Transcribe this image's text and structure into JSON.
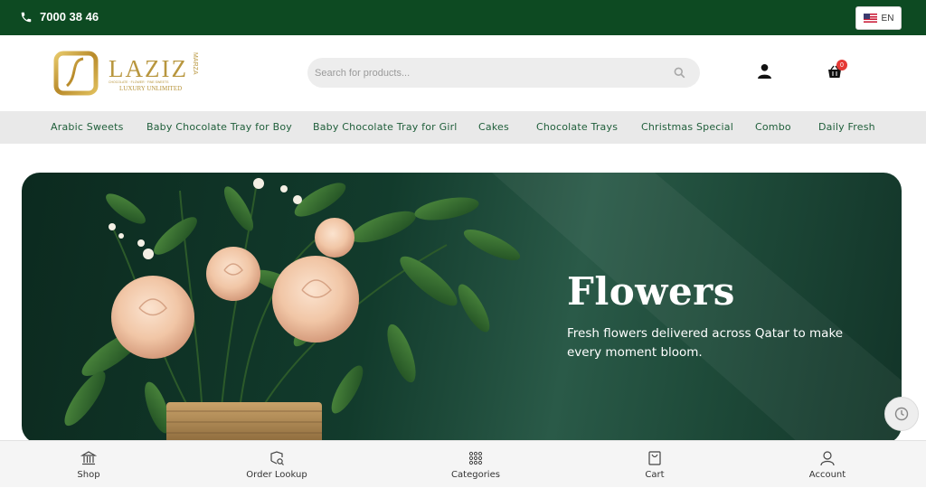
{
  "topbar": {
    "phone": "7000 38 46",
    "language": "EN"
  },
  "logo": {
    "name": "LAZIZ",
    "side": "MARZA",
    "tagline": "LUXURY UNLIMITED",
    "small": "CHOCOLATE · FLOWER · FINE SWEETS"
  },
  "search": {
    "placeholder": "Search for products..."
  },
  "cart": {
    "count": "0"
  },
  "categories": [
    "Arabic Sweets",
    "Baby Chocolate Tray for Boy",
    "Baby Chocolate Tray for Girl",
    "Cakes",
    "Chocolate Trays",
    "Christmas Special",
    "Combo",
    "Daily Fresh"
  ],
  "hero": {
    "title": "Flowers",
    "subtitle": "Fresh flowers delivered across Qatar to make every moment bloom."
  },
  "bottom_nav": [
    {
      "label": "Shop",
      "icon": "shop-icon"
    },
    {
      "label": "Order Lookup",
      "icon": "order-lookup-icon"
    },
    {
      "label": "Categories",
      "icon": "categories-icon"
    },
    {
      "label": "Cart",
      "icon": "cart-icon"
    },
    {
      "label": "Account",
      "icon": "account-icon"
    }
  ],
  "colors": {
    "brand_green": "#0d4a22",
    "nav_text": "#1f5e3a",
    "gold": "#c9a33a",
    "badge": "#e53935"
  }
}
